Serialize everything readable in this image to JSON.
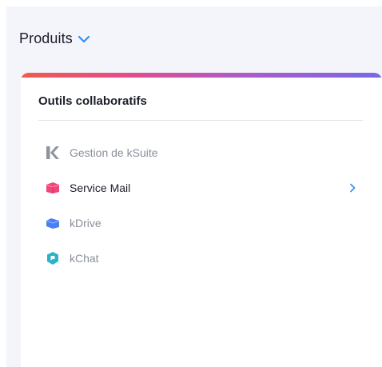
{
  "header": {
    "products_label": "Produits"
  },
  "panel": {
    "title": "Outils collaboratifs",
    "items": [
      {
        "label": "Gestion de kSuite",
        "icon": "ksuite-k-icon",
        "active": false
      },
      {
        "label": "Service Mail",
        "icon": "mail-service-icon",
        "active": true
      },
      {
        "label": "kDrive",
        "icon": "kdrive-icon",
        "active": false
      },
      {
        "label": "kChat",
        "icon": "kchat-icon",
        "active": false
      }
    ]
  },
  "colors": {
    "accent": "#2f8ff5",
    "gradient": [
      "#f05a4c",
      "#e54b8e",
      "#b05ac8",
      "#7a68e6"
    ],
    "text_primary": "#1c1f2a",
    "text_muted": "#8a8f9c",
    "background": "#f3f5fb"
  }
}
